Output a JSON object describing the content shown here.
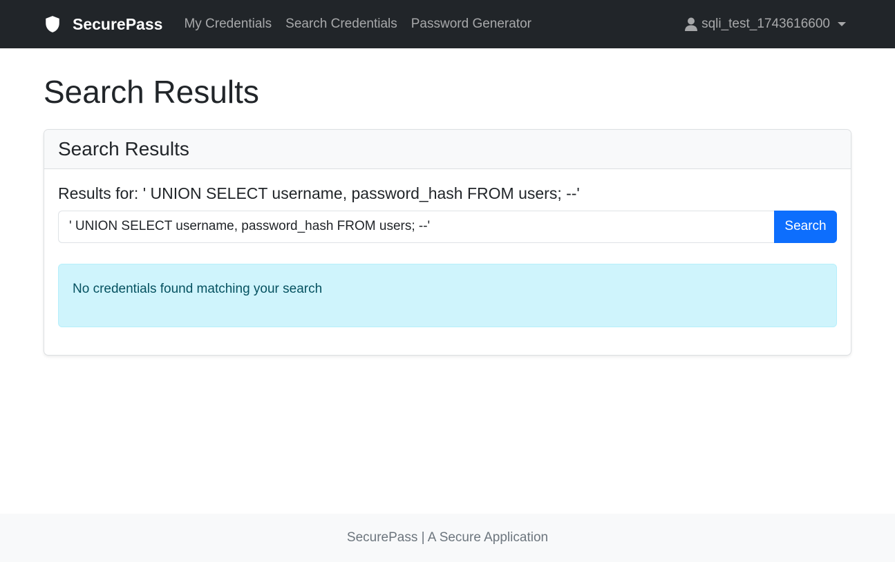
{
  "navbar": {
    "brand": "SecurePass",
    "brand_icon": "shield-icon",
    "links": [
      "My Credentials",
      "Search Credentials",
      "Password Generator"
    ],
    "user": "sqli_test_1743616600",
    "user_icon": "user-icon"
  },
  "page": {
    "title": "Search Results"
  },
  "card": {
    "header": "Search Results",
    "results_label": "Results for: ' UNION SELECT username, password_hash FROM users; --'",
    "search_value": "' UNION SELECT username, password_hash FROM users; --'",
    "search_button": "Search",
    "alert": "No credentials found matching your search"
  },
  "footer": {
    "text": "SecurePass | A Secure Application"
  },
  "colors": {
    "navbar_bg": "#212529",
    "primary": "#0d6efd",
    "alert_bg": "#cff4fc",
    "alert_text": "#055160"
  }
}
